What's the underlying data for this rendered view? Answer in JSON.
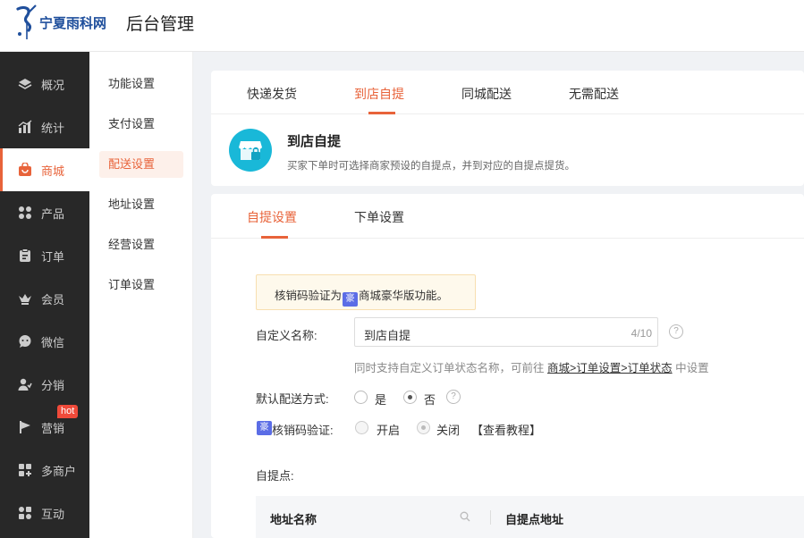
{
  "header": {
    "logo_text": "宁夏雨科网",
    "app_title": "后台管理"
  },
  "sidebar": {
    "items": [
      {
        "label": "概况",
        "icon": "layers-icon"
      },
      {
        "label": "统计",
        "icon": "chart-icon"
      },
      {
        "label": "商城",
        "icon": "shop-bag-icon",
        "active": true
      },
      {
        "label": "产品",
        "icon": "grid-icon"
      },
      {
        "label": "订单",
        "icon": "clipboard-icon"
      },
      {
        "label": "会员",
        "icon": "crown-icon"
      },
      {
        "label": "微信",
        "icon": "chat-icon"
      },
      {
        "label": "分销",
        "icon": "users-icon"
      },
      {
        "label": "营销",
        "icon": "flag-icon",
        "badge": "hot"
      },
      {
        "label": "多商户",
        "icon": "store-plus-icon"
      },
      {
        "label": "互动",
        "icon": "apps-icon"
      }
    ]
  },
  "subnav": {
    "items": [
      {
        "label": "功能设置"
      },
      {
        "label": "支付设置"
      },
      {
        "label": "配送设置",
        "active": true
      },
      {
        "label": "地址设置"
      },
      {
        "label": "经营设置"
      },
      {
        "label": "订单设置"
      }
    ]
  },
  "delivery_tabs": [
    {
      "label": "快递发货"
    },
    {
      "label": "到店自提",
      "active": true
    },
    {
      "label": "同城配送"
    },
    {
      "label": "无需配送"
    }
  ],
  "info": {
    "title": "到店自提",
    "description": "买家下单时可选择商家预设的自提点，并到对应的自提点提货。"
  },
  "form_tabs": [
    {
      "label": "自提设置",
      "active": true
    },
    {
      "label": "下单设置"
    }
  ],
  "notice": {
    "prefix": "核销码验证为",
    "badge": "豪",
    "suffix": "商城豪华版功能。"
  },
  "form": {
    "custom_name_label": "自定义名称:",
    "custom_name_value": "到店自提",
    "custom_name_count": "4/10",
    "help_mark": "?",
    "hint_prefix": "同时支持自定义订单状态名称，可前往",
    "hint_link": "商城>订单设置>订单状态",
    "hint_suffix": "中设置",
    "default_method_label": "默认配送方式:",
    "default_yes": "是",
    "default_no": "否",
    "verify_badge": "豪",
    "verify_label": "核销码验证:",
    "verify_on": "开启",
    "verify_off": "关闭",
    "tutorial_link": "【查看教程】",
    "pickup_points_label": "自提点:"
  },
  "table": {
    "columns": [
      "地址名称",
      "自提点地址"
    ]
  },
  "colors": {
    "accent": "#e8633a",
    "sidebar_bg": "#282828",
    "notice_bg": "#fef9ec",
    "luxury_badge": "#5b6de6"
  }
}
